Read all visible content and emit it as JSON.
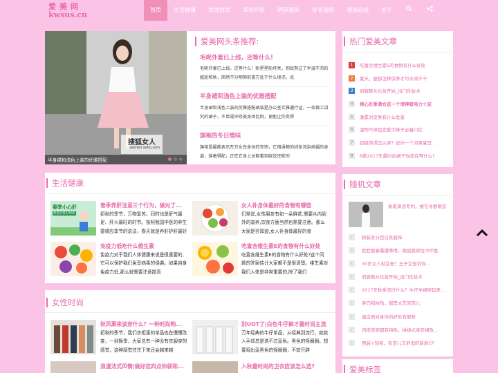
{
  "logo": {
    "line1": "爱美网",
    "line2": "kwsus.cn"
  },
  "nav": {
    "items": [
      "首页",
      "生活健康",
      "女性时尚",
      "美容护肤",
      "明星服饰",
      "穿衣搭配",
      "潮流前线",
      "关于"
    ],
    "search_icon": "search-icon",
    "share_icon": "share-icon"
  },
  "slider": {
    "caption": "半身裙和浅色上装的优雅搭配",
    "watermark1": "搜狐女人",
    "watermark2": "women.sohu.com"
  },
  "headline": {
    "section_title": "爱美网头条推荐:",
    "items": [
      {
        "title": "毛呢外套已上线，还等什么!",
        "excerpt": "毛呢外套已上线，还等什么！盼星星盼月亮，到底熬过了半温不凉的尴尬和秋，固然不分明但前南方处于什么境况，北"
      },
      {
        "title": "半身裙和浅色上装的优雅搭配",
        "excerpt": "半身裙和浅色上装的优雅搭配裙装是办公室文雅通行证，一条做工讲究的裙子，不单或许修美身体比例，更能让你变得"
      },
      {
        "title": "旗袍的冬日情味",
        "excerpt": "旗袍是最能表示东方女性身体的衣饰，它用涌畅的线条流染娇媚的身姿，穿着得配，正在它身上总能看到欧说还欺的"
      }
    ]
  },
  "hot": {
    "title": "热门爱美文章",
    "items": [
      {
        "n": "1",
        "text": "吃富含维生素E的食物有什么好处",
        "color": "#e03a3a"
      },
      {
        "n": "2",
        "text": "夏天，腿部怎样保养才可水润不干",
        "color": "#f07844"
      },
      {
        "n": "3",
        "text": "俏容颜从化妆开始_出门化妆术",
        "color": "#3a7fd6"
      },
      {
        "n": "4",
        "text": "倾心反季清仓这一个增神就电力十足",
        "color": "#e8e8e8"
      },
      {
        "n": "5",
        "text": "激素对皮肤有什么危害",
        "color": "#e8e8e8"
      },
      {
        "n": "6",
        "text": "湿吻不掉色恋爱中妹子必备口红",
        "color": "#e8e8e8"
      },
      {
        "n": "7",
        "text": "超级简谓怎么穿？还你一个凉爽夏日...",
        "color": "#e8e8e8"
      },
      {
        "n": "8",
        "text": "6款2017年最时尚裙子你还在等什么?",
        "color": "#e8e8e8"
      }
    ]
  },
  "life": {
    "title": "生活健康",
    "cards": [
      {
        "title": "春季养肝注意三个行为，做对了...",
        "text": "初秋的季节，万物复苏，同时也是肝气最足、肝火最旺的时节。按照我国中医的养生要顺应季节的说法，春天就是养肝护肝最好的",
        "banner": "春季小心肝",
        "banner2": "养肝护肝好时机"
      },
      {
        "title": "女人补身体最好的食物有哪些",
        "text": "们常说,女性朋友有如一朵鲜花,需要从内到外的滋养,饮食方面当然也需要注意。那么大家是否知道,女人补身体最好的食"
      },
      {
        "title": "免疫力低吃什么维生素",
        "text": "免疫力对于我们人体健康来说是很重要的,它可以保护我们免受病毒的侵袭。如果自身免疫力低,那么就需要注意提高"
      },
      {
        "title": "吃富含维生素E的食物有什么好处",
        "text": "吃富含维生素E的食物有什么好处?这个问题的答案估计大家都不是很清楚。维生素对我们人体是非常重要的,除了我们"
      }
    ]
  },
  "fashion": {
    "title": "女性时尚",
    "cards": [
      {
        "title": "秋风萧来该穿什么？一种时尚哟...",
        "text": "初秋的季节，我们衣柜里的单品也在慢慢改变，一到换季，大家总有一种没有衣服穿的感觉，这种感觉往往下来还会越来越"
      },
      {
        "title": "别UOT了|白色牛仔裤才最时尚主流",
        "text": "万年经典的牛仔单品，从经典到流行，款款入手却总是迭不过蓝色。黑色的怪圈圈。想要观出蓝黑色的怪圈圈，不妨开辟"
      },
      {
        "title": "浪漫法式风情|做好这四点你就和..."
      },
      {
        "title": "入秋最时尚的卫衣应该怎么选?"
      }
    ]
  },
  "random": {
    "title": "随机文章",
    "feature": "春夏滴浪专利，撩空寻丽歌恋",
    "items": [
      "粉装各分百日系服饰",
      "脸脸换春暑爆事情，晚饭腐穿拉中坏胜",
      "30岁女人就变老？王子文告诉你...",
      "俏容颜从化妆开始_出门化妆术",
      "2017年秋季流行什么？牛仔半裙穿起来...",
      "寿巧和依热，都是文艺的范儿",
      "蛋白质对身体的好处有哪些",
      "内搭单穿都有特色，拼接式连衣裙放...",
      "西装+短裤，有范儿又舒坦的新款CP"
    ]
  },
  "tags": {
    "title": "爱美标签"
  },
  "colors": {
    "accent": "#e86aa8",
    "background": "#fbc4e6"
  }
}
